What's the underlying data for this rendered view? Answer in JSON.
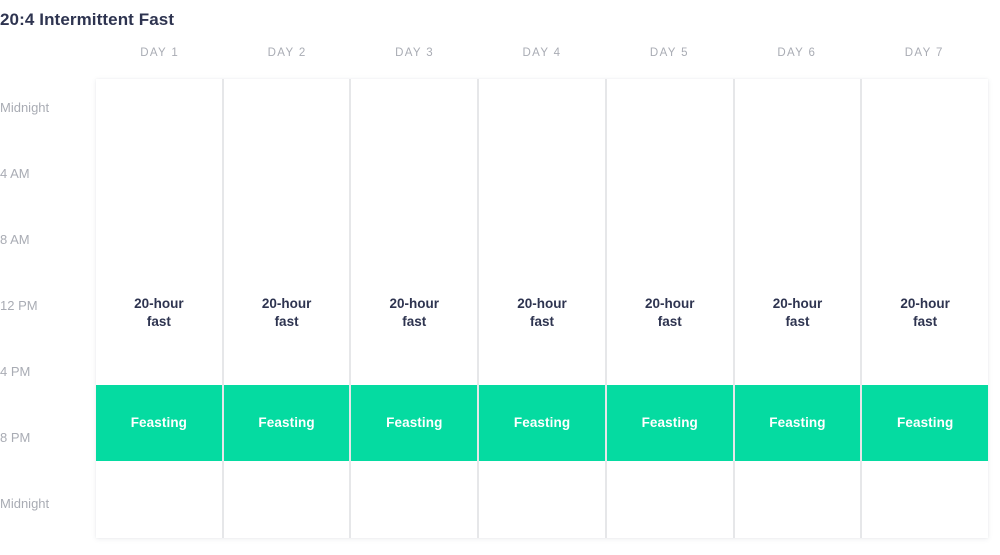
{
  "title": "20:4 Intermittent Fast",
  "accent_color": "#05DBA1",
  "title_color": "#2E3450",
  "axis_label_color": "#A9ACB4",
  "grid_line_color": "#E6E7E9",
  "time_axis": {
    "labels": [
      "Midnight",
      "4 AM",
      "8 AM",
      "12 PM",
      "4 PM",
      "8 PM",
      "Midnight"
    ],
    "positions_pct": [
      6.3,
      20.7,
      35.1,
      49.5,
      63.9,
      78.3,
      92.7
    ]
  },
  "days": [
    {
      "header": "DAY 1",
      "fast_line1": "20-hour",
      "fast_line2": "fast",
      "feast_label": "Feasting"
    },
    {
      "header": "DAY 2",
      "fast_line1": "20-hour",
      "fast_line2": "fast",
      "feast_label": "Feasting"
    },
    {
      "header": "DAY 3",
      "fast_line1": "20-hour",
      "fast_line2": "fast",
      "feast_label": "Feasting"
    },
    {
      "header": "DAY 4",
      "fast_line1": "20-hour",
      "fast_line2": "fast",
      "feast_label": "Feasting"
    },
    {
      "header": "DAY 5",
      "fast_line1": "20-hour",
      "fast_line2": "fast",
      "feast_label": "Feasting"
    },
    {
      "header": "DAY 6",
      "fast_line1": "20-hour",
      "fast_line2": "fast",
      "feast_label": "Feasting"
    },
    {
      "header": "DAY 7",
      "fast_line1": "20-hour",
      "fast_line2": "fast",
      "feast_label": "Feasting"
    }
  ],
  "chart_data": {
    "type": "heatmap",
    "title": "20:4 Intermittent Fast",
    "xlabel": "",
    "ylabel": "",
    "categories": [
      "DAY 1",
      "DAY 2",
      "DAY 3",
      "DAY 4",
      "DAY 5",
      "DAY 6",
      "DAY 7"
    ],
    "y_tick_labels": [
      "Midnight",
      "4 AM",
      "8 AM",
      "12 PM",
      "4 PM",
      "8 PM",
      "Midnight"
    ],
    "y_tick_hours": [
      0,
      4,
      8,
      12,
      16,
      20,
      24
    ],
    "ylim": [
      0,
      24
    ],
    "grid": true,
    "legend": "none",
    "series": [
      {
        "name": "20-hour fast",
        "color": "#FFFFFF",
        "label": "20-hour fast",
        "duration_hours": 20,
        "blocks": [
          {
            "day": "DAY 1",
            "start_hour": 0,
            "end_hour": 16
          },
          {
            "day": "DAY 1",
            "start_hour": 20,
            "end_hour": 24
          },
          {
            "day": "DAY 2",
            "start_hour": 0,
            "end_hour": 16
          },
          {
            "day": "DAY 2",
            "start_hour": 20,
            "end_hour": 24
          },
          {
            "day": "DAY 3",
            "start_hour": 0,
            "end_hour": 16
          },
          {
            "day": "DAY 3",
            "start_hour": 20,
            "end_hour": 24
          },
          {
            "day": "DAY 4",
            "start_hour": 0,
            "end_hour": 16
          },
          {
            "day": "DAY 4",
            "start_hour": 20,
            "end_hour": 24
          },
          {
            "day": "DAY 5",
            "start_hour": 0,
            "end_hour": 16
          },
          {
            "day": "DAY 5",
            "start_hour": 20,
            "end_hour": 24
          },
          {
            "day": "DAY 6",
            "start_hour": 0,
            "end_hour": 16
          },
          {
            "day": "DAY 6",
            "start_hour": 20,
            "end_hour": 24
          },
          {
            "day": "DAY 7",
            "start_hour": 0,
            "end_hour": 16
          },
          {
            "day": "DAY 7",
            "start_hour": 20,
            "end_hour": 24
          }
        ]
      },
      {
        "name": "Feasting",
        "color": "#05DBA1",
        "label": "Feasting",
        "duration_hours": 4,
        "blocks": [
          {
            "day": "DAY 1",
            "start_hour": 16,
            "end_hour": 20
          },
          {
            "day": "DAY 2",
            "start_hour": 16,
            "end_hour": 20
          },
          {
            "day": "DAY 3",
            "start_hour": 16,
            "end_hour": 20
          },
          {
            "day": "DAY 4",
            "start_hour": 16,
            "end_hour": 20
          },
          {
            "day": "DAY 5",
            "start_hour": 16,
            "end_hour": 20
          },
          {
            "day": "DAY 6",
            "start_hour": 16,
            "end_hour": 20
          },
          {
            "day": "DAY 7",
            "start_hour": 16,
            "end_hour": 20
          }
        ]
      }
    ]
  }
}
